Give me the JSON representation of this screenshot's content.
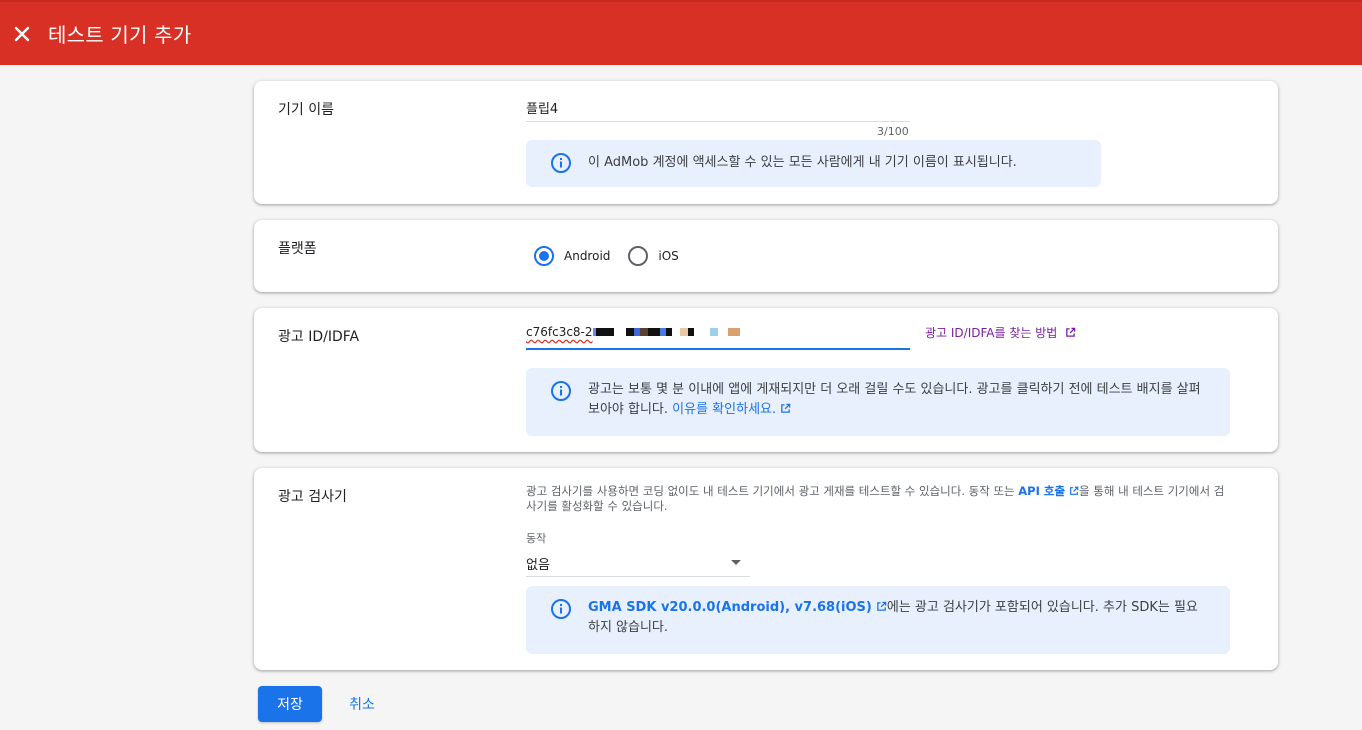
{
  "colors": {
    "accent_red": "#d93025",
    "primary_blue": "#1a73e8",
    "info_bg": "#e8f0fe",
    "link_purple": "#7b1fa2"
  },
  "header": {
    "close_icon": "close-icon",
    "title": "테스트 기기 추가"
  },
  "device_name": {
    "label": "기기 이름",
    "value": "플립4",
    "counter": "3/100",
    "info_icon": "info-icon",
    "info": "이 AdMob 계정에 액세스할 수 있는 모든 사람에게 내 기기 이름이 표시됩니다."
  },
  "platform": {
    "label": "플랫폼",
    "options": [
      {
        "label": "Android",
        "selected": true
      },
      {
        "label": "iOS",
        "selected": false
      }
    ]
  },
  "ad_id": {
    "label": "광고 ID/IDFA",
    "value_prefix": "c76fc3c8-2",
    "help_link": "광고 ID/IDFA를 찾는 방법",
    "info_icon": "info-icon",
    "info": "광고는 보통 몇 분 이내에 앱에 게재되지만 더 오래 걸릴 수도 있습니다. 광고를 클릭하기 전에 테스트 배지를 살펴보아야 합니다.",
    "info_link": "이유를 확인하세요."
  },
  "ad_inspector": {
    "label": "광고 검사기",
    "desc_before": "광고 검사기를 사용하면 코딩 없이도 내 테스트 기기에서 광고 게재를 테스트할 수 있습니다. 동작 또는",
    "desc_link": "API 호출",
    "desc_after": "을 통해 내 테스트 기기에서 검사기를 활성화할 수 있습니다.",
    "gesture_label": "동작",
    "gesture_value": "없음",
    "info_icon": "info-icon",
    "info_link": "GMA SDK v20.0.0(Android), v7.68(iOS)",
    "info_after": "에는 광고 검사기가 포함되어 있습니다. 추가 SDK는 필요하지 않습니다."
  },
  "actions": {
    "save": "저장",
    "cancel": "취소"
  }
}
